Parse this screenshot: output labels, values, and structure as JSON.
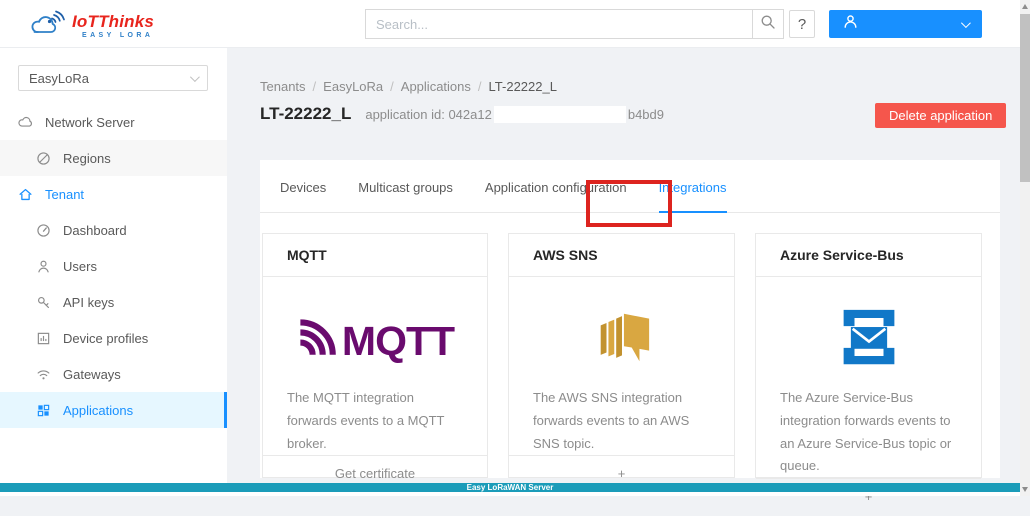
{
  "header": {
    "logo_title": "IoTThinks",
    "logo_subtitle": "EASY LORA",
    "search_placeholder": "Search...",
    "help_label": "?"
  },
  "sidebar": {
    "org_select_value": "EasyLoRa",
    "items": [
      {
        "label": "Network Server",
        "icon": "cloud-icon"
      },
      {
        "label": "Regions",
        "icon": "compass-icon"
      },
      {
        "label": "Tenant",
        "icon": "home-icon"
      },
      {
        "label": "Dashboard",
        "icon": "dashboard-icon"
      },
      {
        "label": "Users",
        "icon": "user-icon"
      },
      {
        "label": "API keys",
        "icon": "key-icon"
      },
      {
        "label": "Device profiles",
        "icon": "device-profile-icon"
      },
      {
        "label": "Gateways",
        "icon": "wifi-icon"
      },
      {
        "label": "Applications",
        "icon": "grid-icon"
      }
    ]
  },
  "breadcrumb": {
    "separator": "/",
    "items": [
      "Tenants",
      "EasyLoRa",
      "Applications",
      "LT-22222_L"
    ]
  },
  "page": {
    "title": "LT-22222_L",
    "app_id_prefix": "application id: 042a12",
    "app_id_suffix": "b4bd9",
    "delete_button": "Delete application"
  },
  "tabs": [
    "Devices",
    "Multicast groups",
    "Application configuration",
    "Integrations"
  ],
  "cards": [
    {
      "title": "MQTT",
      "logo_text": "MQTT",
      "description": "The MQTT integration forwards events to a MQTT broker.",
      "action": "Get certificate"
    },
    {
      "title": "AWS SNS",
      "description": "The AWS SNS integration forwards events to an AWS SNS topic.",
      "action": "+"
    },
    {
      "title": "Azure Service-Bus",
      "description": "The Azure Service-Bus integration forwards events to an Azure Service-Bus topic or queue.",
      "action": "+"
    }
  ],
  "footer": {
    "label": "Easy LoRaWAN Server"
  },
  "colors": {
    "accent_blue": "#1890ff",
    "danger_red": "#f5564c",
    "annotation_red": "#dd241f",
    "footer_teal": "#1b9cb9",
    "mqtt_purple": "#6a0b6e",
    "aws_gold": "#d9a741",
    "azure_blue": "#1178c8",
    "sidebar_active_bg": "#e6f7ff"
  }
}
